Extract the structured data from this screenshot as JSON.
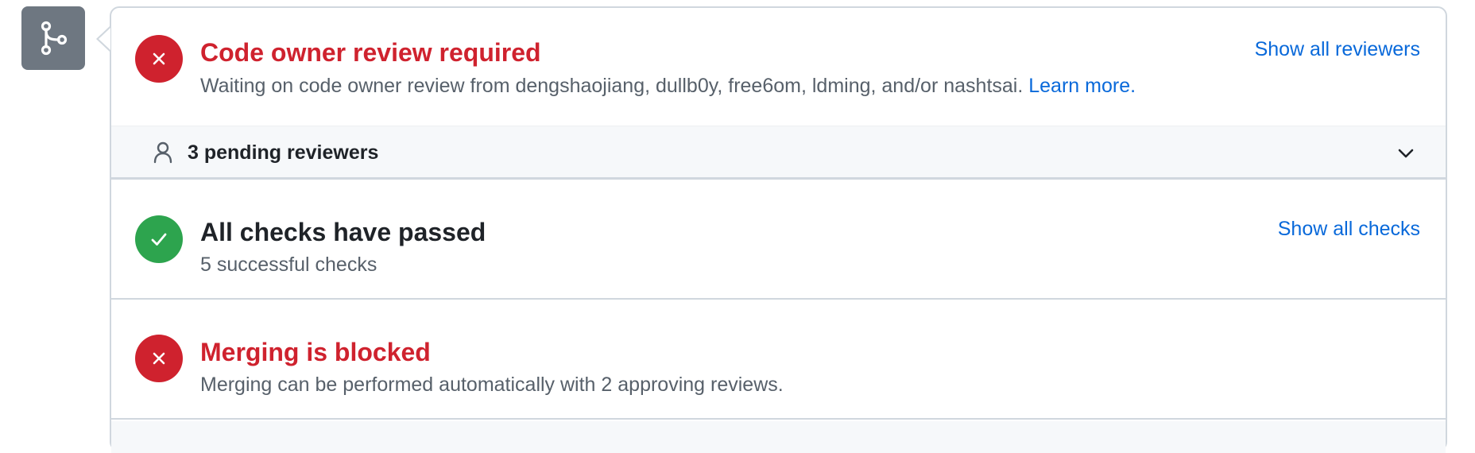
{
  "review": {
    "title": "Code owner review required",
    "description": "Waiting on code owner review from dengshaojiang, dullb0y, free6om, ldming, and/or nashtsai.",
    "learn_more": "Learn more.",
    "show_all": "Show all reviewers",
    "status": "failure"
  },
  "pending": {
    "label": "3 pending reviewers"
  },
  "checks": {
    "title": "All checks have passed",
    "description": "5 successful checks",
    "show_all": "Show all checks",
    "status": "success"
  },
  "merge": {
    "title": "Merging is blocked",
    "description": "Merging can be performed automatically with 2 approving reviews.",
    "status": "failure"
  },
  "icons": {
    "badge": "git-merge-icon",
    "failure": "x-icon",
    "success": "check-icon",
    "person": "person-icon",
    "chevron": "chevron-down-icon"
  },
  "colors": {
    "danger": "#cf222e",
    "success": "#2da44e",
    "link": "#0969da",
    "badge": "#6e7781"
  }
}
